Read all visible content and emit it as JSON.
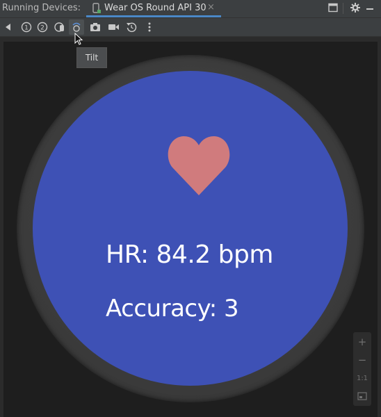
{
  "header": {
    "panel_title": "Running Devices:",
    "tab_label": "Wear OS Round API 30",
    "close_glyph": "×",
    "accent_color": "#4a88c7"
  },
  "toolbar": {
    "buttons": [
      "back-icon",
      "rotate-left-icon",
      "rotate-right-icon",
      "touch-icon",
      "tilt-icon",
      "camera-icon",
      "video-icon",
      "reset-icon",
      "more-icon"
    ],
    "tooltip": "Tilt"
  },
  "watch": {
    "screen_color": "#3e51b5",
    "heart_color": "#d07b7d",
    "hr_text": "HR: 84.2 bpm",
    "accuracy_text": "Accuracy: 3"
  },
  "zoom": {
    "zoom_in": "+",
    "zoom_out": "−",
    "actual_size": "1:1",
    "fit_icon": "fit-screen-icon"
  }
}
